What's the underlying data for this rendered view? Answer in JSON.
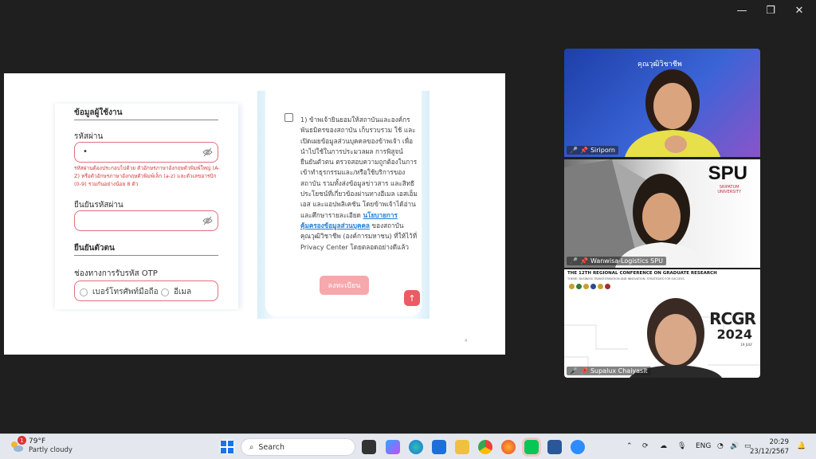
{
  "slide": {
    "form": {
      "section_user": "ข้อมูลผู้ใช้งาน",
      "password_label": "รหัสผ่าน",
      "password_value": "•",
      "password_hint": "รหัสผ่านต้องประกอบไปด้วย ตัวอักษรภาษาอังกฤษตัวพิมพ์ใหญ่ (A-Z) หรือตัวอักษรภาษาอังกฤษตัวพิมพ์เล็ก (a-z) และตัวเลขอารบิก (0-9) รวมกันอย่างน้อย 8 ตัว",
      "confirm_label": "ยืนยันรหัสผ่าน",
      "section_verify": "ยืนยันตัวตน",
      "otp_label": "ช่องทางการรับรหัส OTP",
      "otp_options": [
        "เบอร์โทรศัพท์มือถือ",
        "อีเมล"
      ]
    },
    "consent": {
      "text_before": "1) ข้าพเจ้ายินยอมให้สถาบันและองค์กรพันธมิตรของสถาบัน เก็บรวบรวม ใช้ และเปิดเผยข้อมูลส่วนบุคคลของข้าพเจ้า เพื่อนำไปใช้ในการประมวลผล การพิสูจน์ยืนยันตัวตน ตรวจสอบความถูกต้องในการเข้าทำธุรกรรมและ/หรือใช้บริการของสถาบัน รวมทั้งส่งข้อมูลข่าวสาร และสิทธิประโยชน์ที่เกี่ยวข้องผ่านทางอีเมล เอสเอ็มเอส และแอปพลิเคชัน โดยข้าพเจ้าได้อ่านและศึกษารายละเอียด",
      "link_text": "นโยบายการคุ้มครองข้อมูลส่วนบุคคล",
      "text_after": " ของสถาบันคุณวุฒิวิชาชีพ (องค์การมหาชน) ที่ให้ไว้ที่ Privacy Center โดยตลอดอย่างดีแล้ว",
      "agree_button": "ลงทะเบียน",
      "mark": "4"
    }
  },
  "participants": [
    {
      "name": "Siriporn",
      "banner": "คุณวุฒิวิชาชีพ"
    },
    {
      "name": "Wanwisa-Logistics SPU",
      "logo": "SPU",
      "logo_sub": "SRIPATUM\nUNIVERSITY"
    },
    {
      "name": "Supalux Chaiyasit",
      "banner": "THE 12TH REGIONAL CONFERENCE ON GRADUATE RESEARCH",
      "banner_sub": "THEME: BUSINESS TRANSFORMATION AND INNOVATION: STRATEGIES FOR SUCCESS",
      "logo": "RCGR",
      "logo_year": "2024",
      "logo_date": "19 JULY"
    }
  ],
  "taskbar": {
    "weather_temp": "79°F",
    "weather_cond": "Partly cloudy",
    "weather_badge": "1",
    "search_placeholder": "Search",
    "lang": "ENG",
    "time": "20:29",
    "date": "23/12/2567"
  },
  "colors": {
    "accent_red": "#ec5b63",
    "link_blue": "#1f7fd6",
    "hint_red": "#d23b3b"
  }
}
